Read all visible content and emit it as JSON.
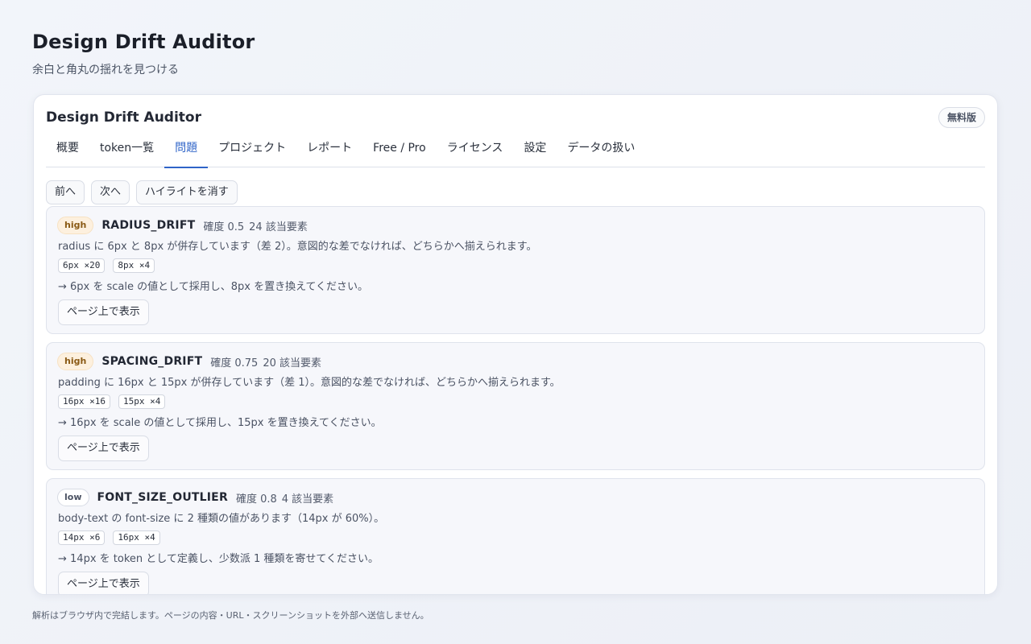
{
  "header": {
    "title": "Design Drift Auditor",
    "subtitle": "余白と角丸の揺れを見つける"
  },
  "panel": {
    "title": "Design Drift Auditor",
    "plan_badge": "無料版"
  },
  "tabs": [
    {
      "label": "概要",
      "active": false
    },
    {
      "label": "token一覧",
      "active": false
    },
    {
      "label": "問題",
      "active": true
    },
    {
      "label": "プロジェクト",
      "active": false
    },
    {
      "label": "レポート",
      "active": false
    },
    {
      "label": "Free / Pro",
      "active": false
    },
    {
      "label": "ライセンス",
      "active": false
    },
    {
      "label": "設定",
      "active": false
    },
    {
      "label": "データの扱い",
      "active": false
    }
  ],
  "nav": {
    "prev_label": "前へ",
    "next_label": "次へ",
    "clear_label": "ハイライトを消す"
  },
  "issues": [
    {
      "severity": "high",
      "code": "RADIUS_DRIFT",
      "confidence": "確度 0.5",
      "count": "24 該当要素",
      "description": "radius に 6px と 8px が併存しています（差 2）。意図的な差でなければ、どちらかへ揃えられます。",
      "chips": [
        "6px ×20",
        "8px ×4"
      ],
      "fix": "→ 6px を scale の値として採用し、8px を置き換えてください。",
      "show_label": "ページ上で表示"
    },
    {
      "severity": "high",
      "code": "SPACING_DRIFT",
      "confidence": "確度 0.75",
      "count": "20 該当要素",
      "description": "padding に 16px と 15px が併存しています（差 1）。意図的な差でなければ、どちらかへ揃えられます。",
      "chips": [
        "16px ×16",
        "15px ×4"
      ],
      "fix": "→ 16px を scale の値として採用し、15px を置き換えてください。",
      "show_label": "ページ上で表示"
    },
    {
      "severity": "low",
      "code": "FONT_SIZE_OUTLIER",
      "confidence": "確度 0.8",
      "count": "4 該当要素",
      "description": "body-text の font-size に 2 種類の値があります（14px が 60%）。",
      "chips": [
        "14px ×6",
        "16px ×4"
      ],
      "fix": "→ 14px を token として定義し、少数派 1 種類を寄せてください。",
      "show_label": "ページ上で表示"
    }
  ],
  "footer": {
    "note": "解析はブラウザ内で完結します。ページの内容・URL・スクリーンショットを外部へ送信しません。"
  },
  "colors": {
    "accent": "#2f64c8",
    "high_bg": "#fdf0de",
    "page_bg": "#eff2f8"
  }
}
